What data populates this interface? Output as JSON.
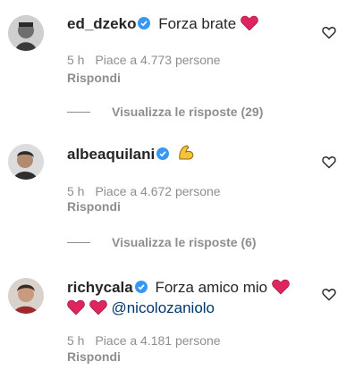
{
  "comments": [
    {
      "username": "ed_dzeko",
      "text": "Forza brate",
      "time": "5 h",
      "likes": "Piace a 4.773 persone",
      "reply": "Rispondi",
      "view_replies": "Visualizza le risposte (29)"
    },
    {
      "username": "albeaquilani",
      "text": "",
      "time": "5 h",
      "likes": "Piace a 4.672 persone",
      "reply": "Rispondi",
      "view_replies": "Visualizza le risposte (6)"
    },
    {
      "username": "richycala",
      "text": "Forza amico mio",
      "mention": "@nicolozaniolo",
      "time": "5 h",
      "likes": "Piace a 4.181 persone",
      "reply": "Rispondi"
    }
  ],
  "colors": {
    "verified": "#3897f0",
    "emoji_heart": "#e0245e",
    "mention": "#00376b",
    "meta": "#8e8e8e"
  },
  "icons": {
    "verified": "verified-badge-icon",
    "like": "heart-outline-icon",
    "flexed_biceps": "flexed-biceps-emoji"
  }
}
